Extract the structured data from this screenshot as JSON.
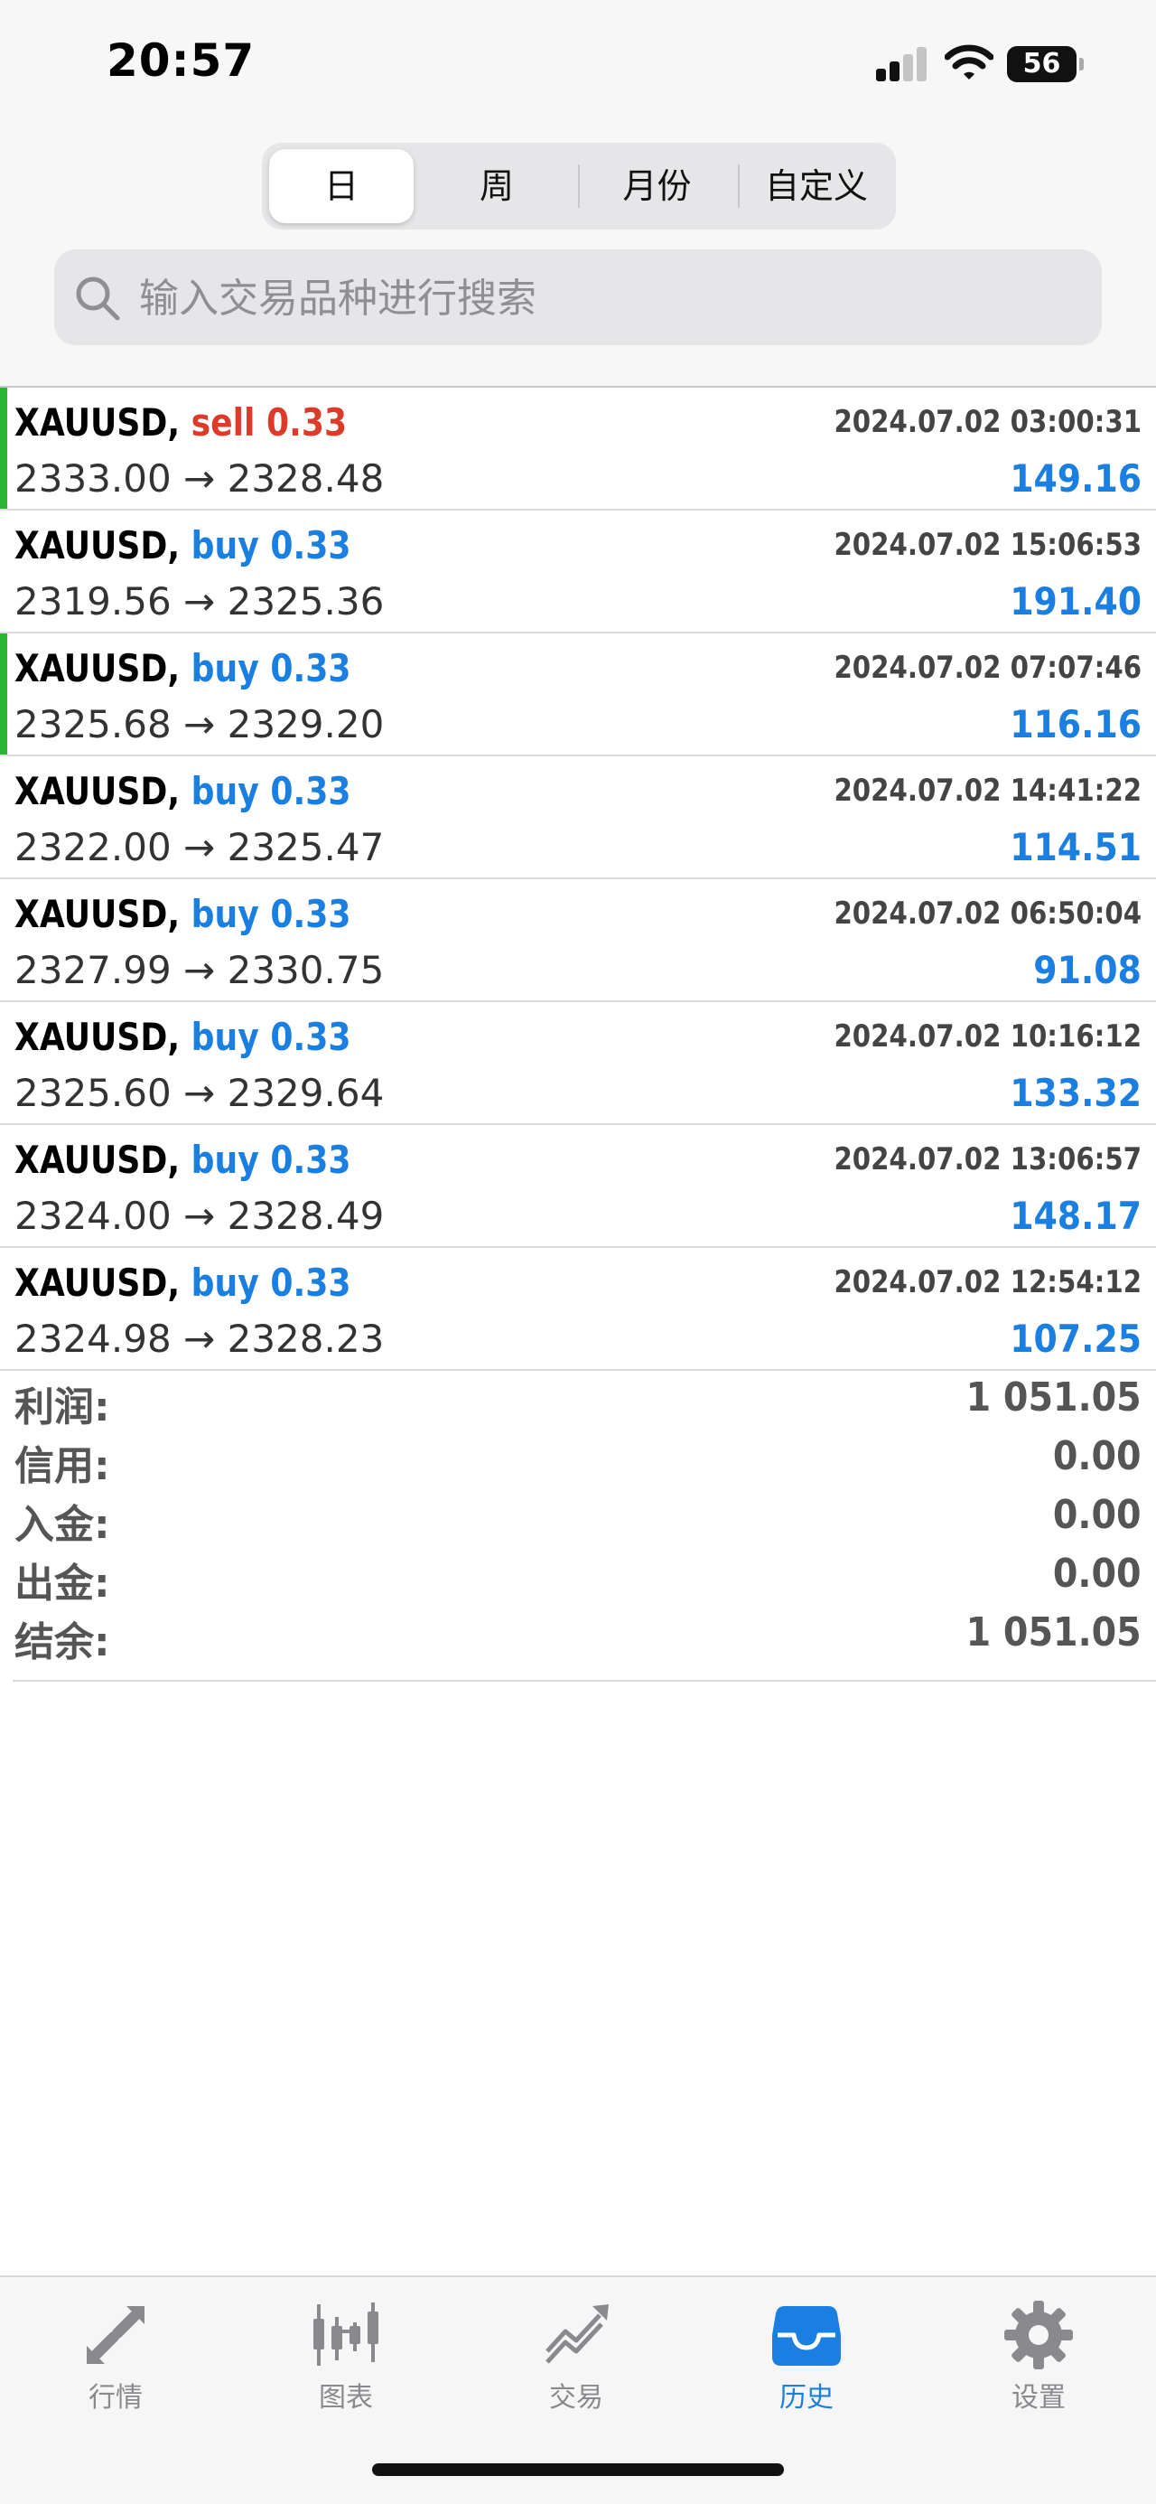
{
  "status_bar": {
    "time": "20:57",
    "battery": "56"
  },
  "period_tabs": [
    {
      "label": "日",
      "active": true
    },
    {
      "label": "周",
      "active": false
    },
    {
      "label": "月份",
      "active": false
    },
    {
      "label": "自定义",
      "active": false
    }
  ],
  "search": {
    "placeholder": "输入交易品种进行搜索",
    "value": ""
  },
  "colors": {
    "sell": "#dd3b2a",
    "buy": "#1a7fe0",
    "profit": "#1a7fe0",
    "marker": "#2bb534",
    "tab_active": "#1a7fe0",
    "tab_inactive": "#8a8a8e"
  },
  "trades": [
    {
      "symbol": "XAUUSD,",
      "side": "sell",
      "volume": "0.33",
      "time": "2024.07.02 03:00:31",
      "open": "2333.00",
      "close": "2328.48",
      "profit": "149.16",
      "marked": true
    },
    {
      "symbol": "XAUUSD,",
      "side": "buy",
      "volume": "0.33",
      "time": "2024.07.02 15:06:53",
      "open": "2319.56",
      "close": "2325.36",
      "profit": "191.40",
      "marked": false
    },
    {
      "symbol": "XAUUSD,",
      "side": "buy",
      "volume": "0.33",
      "time": "2024.07.02 07:07:46",
      "open": "2325.68",
      "close": "2329.20",
      "profit": "116.16",
      "marked": true
    },
    {
      "symbol": "XAUUSD,",
      "side": "buy",
      "volume": "0.33",
      "time": "2024.07.02 14:41:22",
      "open": "2322.00",
      "close": "2325.47",
      "profit": "114.51",
      "marked": false
    },
    {
      "symbol": "XAUUSD,",
      "side": "buy",
      "volume": "0.33",
      "time": "2024.07.02 06:50:04",
      "open": "2327.99",
      "close": "2330.75",
      "profit": "91.08",
      "marked": false
    },
    {
      "symbol": "XAUUSD,",
      "side": "buy",
      "volume": "0.33",
      "time": "2024.07.02 10:16:12",
      "open": "2325.60",
      "close": "2329.64",
      "profit": "133.32",
      "marked": false
    },
    {
      "symbol": "XAUUSD,",
      "side": "buy",
      "volume": "0.33",
      "time": "2024.07.02 13:06:57",
      "open": "2324.00",
      "close": "2328.49",
      "profit": "148.17",
      "marked": false
    },
    {
      "symbol": "XAUUSD,",
      "side": "buy",
      "volume": "0.33",
      "time": "2024.07.02 12:54:12",
      "open": "2324.98",
      "close": "2328.23",
      "profit": "107.25",
      "marked": false
    }
  ],
  "price_arrow": "→",
  "summary": [
    {
      "label": "利润:",
      "value": "1 051.05"
    },
    {
      "label": "信用:",
      "value": "0.00"
    },
    {
      "label": "入金:",
      "value": "0.00"
    },
    {
      "label": "出金:",
      "value": "0.00"
    },
    {
      "label": "结余:",
      "value": "1 051.05"
    }
  ],
  "tabbar": [
    {
      "label": "行情",
      "icon": "quotes-arrows-icon",
      "active": false
    },
    {
      "label": "图表",
      "icon": "candlestick-chart-icon",
      "active": false
    },
    {
      "label": "交易",
      "icon": "trade-trend-icon",
      "active": false
    },
    {
      "label": "历史",
      "icon": "history-inbox-icon",
      "active": true
    },
    {
      "label": "设置",
      "icon": "gear-icon",
      "active": false
    }
  ]
}
